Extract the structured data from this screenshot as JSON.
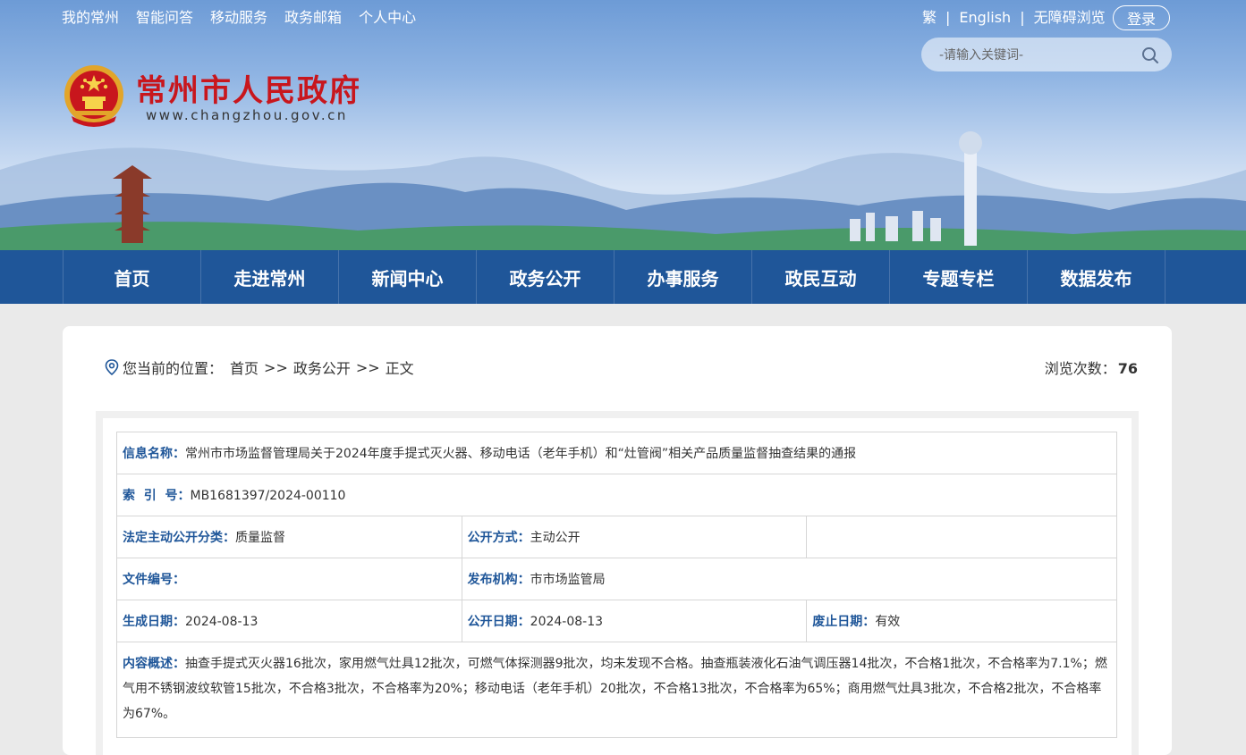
{
  "top_nav": [
    "我的常州",
    "智能问答",
    "移动服务",
    "政务邮箱",
    "个人中心"
  ],
  "top_links": {
    "traditional": "繁",
    "english": "English",
    "accessible": "无障碍浏览",
    "separator": "|",
    "login": "登录"
  },
  "search": {
    "placeholder": "-请输入关键词-"
  },
  "site": {
    "title": "常州市人民政府",
    "url": "www.changzhou.gov.cn"
  },
  "main_nav": [
    "首页",
    "走进常州",
    "新闻中心",
    "政务公开",
    "办事服务",
    "政民互动",
    "专题专栏",
    "数据发布"
  ],
  "breadcrumb": {
    "label": "您当前的位置：",
    "items": [
      "首页",
      "政务公开",
      "正文"
    ],
    "arrow": ">>"
  },
  "views": {
    "label": "浏览次数：",
    "count": "76"
  },
  "info": {
    "name_label": "信息名称：",
    "name_value": "常州市市场监督管理局关于2024年度手提式灭火器、移动电话（老年手机）和“灶管阀”相关产品质量监督抽查结果的通报",
    "index_label": "索  引  号：",
    "index_value": "MB1681397/2024-00110",
    "category_label": "法定主动公开分类：",
    "category_value": "质量监督",
    "method_label": "公开方式：",
    "method_value": "主动公开",
    "docno_label": "文件编号：",
    "docno_value": "",
    "publisher_label": "发布机构：",
    "publisher_value": "市市场监管局",
    "created_label": "生成日期：",
    "created_value": "2024-08-13",
    "published_label": "公开日期：",
    "published_value": "2024-08-13",
    "expiry_label": "废止日期：",
    "expiry_value": "有效",
    "summary_label": "内容概述：",
    "summary_value": "抽查手提式灭火器16批次，家用燃气灶具12批次，可燃气体探测器9批次，均未发现不合格。抽查瓶装液化石油气调压器14批次，不合格1批次，不合格率为7.1%；燃气用不锈钢波纹软管15批次，不合格3批次，不合格率为20%；移动电话（老年手机）20批次，不合格13批次，不合格率为65%；商用燃气灶具3批次，不合格2批次，不合格率为67%。"
  },
  "colors": {
    "nav_bg": "#1f5699",
    "title_red": "#c8161d",
    "label_blue": "#1f5699"
  }
}
